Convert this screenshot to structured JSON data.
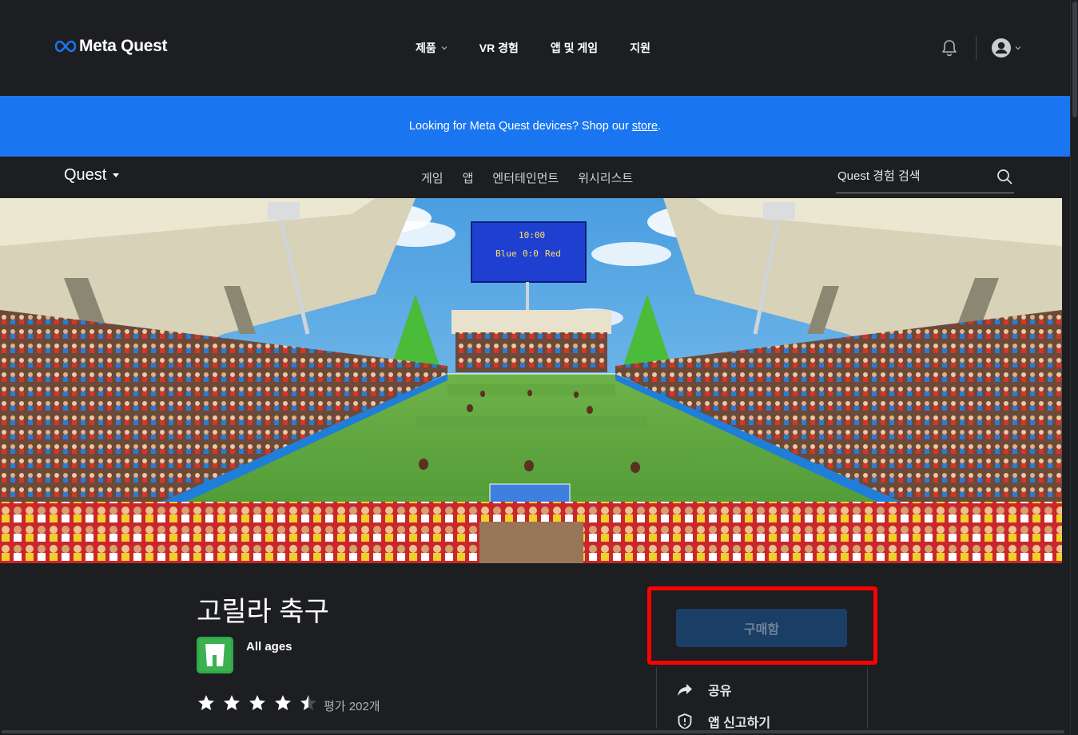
{
  "brand": {
    "name": "Meta Quest"
  },
  "topnav": {
    "items": [
      {
        "label": "제품",
        "has_dropdown": true
      },
      {
        "label": "VR 경험"
      },
      {
        "label": "앱 및 게임"
      },
      {
        "label": "지원"
      }
    ]
  },
  "banner": {
    "text": "Looking for Meta Quest devices? Shop our",
    "link": "store",
    "suffix": "."
  },
  "subnav": {
    "menu": "Quest",
    "tabs": [
      "게임",
      "앱",
      "엔터테인먼트",
      "위시리스트"
    ],
    "search_placeholder": "Quest 경험 검색"
  },
  "hero": {
    "scoreboard": {
      "time": "10:00",
      "home": "Blue",
      "score": "0:0",
      "away": "Red"
    }
  },
  "product": {
    "title": "고릴라 축구",
    "age_rating": "All ages",
    "rating_stars": 4.5,
    "rating_count": "평가 202개",
    "buy_label": "구매함",
    "actions": [
      {
        "label": "공유",
        "icon": "share-icon"
      },
      {
        "label": "앱 신고하기",
        "icon": "shield-icon"
      }
    ]
  },
  "colors": {
    "accent": "#1a75f0",
    "background": "#1c1e21",
    "highlight_box": "#ff0000",
    "buy_button": "#1b3e66"
  }
}
